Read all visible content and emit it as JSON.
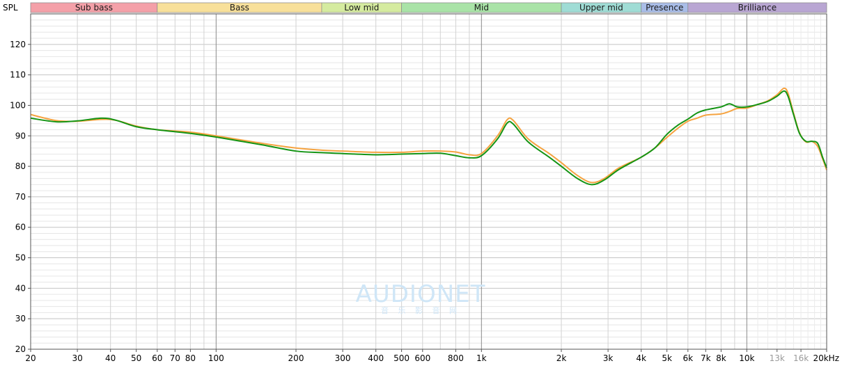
{
  "chart_data": {
    "type": "line",
    "ylabel": "SPL",
    "xunit": "Hz",
    "x_scale": "log",
    "xlim": [
      20,
      20000
    ],
    "ylim": [
      20,
      130
    ],
    "grid": true,
    "y_ticks": [
      20,
      30,
      40,
      50,
      60,
      70,
      80,
      90,
      100,
      110,
      120
    ],
    "x_ticks": [
      {
        "label": "20",
        "value": 20
      },
      {
        "label": "30",
        "value": 30
      },
      {
        "label": "40",
        "value": 40
      },
      {
        "label": "50",
        "value": 50
      },
      {
        "label": "60",
        "value": 60
      },
      {
        "label": "70",
        "value": 70
      },
      {
        "label": "80",
        "value": 80
      },
      {
        "label": "100",
        "value": 100
      },
      {
        "label": "200",
        "value": 200
      },
      {
        "label": "300",
        "value": 300
      },
      {
        "label": "400",
        "value": 400
      },
      {
        "label": "500",
        "value": 500
      },
      {
        "label": "600",
        "value": 600
      },
      {
        "label": "800",
        "value": 800
      },
      {
        "label": "1k",
        "value": 1000
      },
      {
        "label": "2k",
        "value": 2000
      },
      {
        "label": "3k",
        "value": 3000
      },
      {
        "label": "4k",
        "value": 4000
      },
      {
        "label": "5k",
        "value": 5000
      },
      {
        "label": "6k",
        "value": 6000
      },
      {
        "label": "7k",
        "value": 7000
      },
      {
        "label": "8k",
        "value": 8000
      },
      {
        "label": "10k",
        "value": 10000
      },
      {
        "label": "13k",
        "value": 13000,
        "muted": true
      },
      {
        "label": "16k",
        "value": 16000,
        "muted": true
      },
      {
        "label": "20kHz",
        "value": 20000
      }
    ],
    "bands": [
      {
        "name": "Sub bass",
        "from": 20,
        "to": 60,
        "color": "#f4a0a8"
      },
      {
        "name": "Bass",
        "from": 60,
        "to": 250,
        "color": "#f8e09a"
      },
      {
        "name": "Low mid",
        "from": 250,
        "to": 500,
        "color": "#d5eb9f"
      },
      {
        "name": "Mid",
        "from": 500,
        "to": 2000,
        "color": "#a9e3a7"
      },
      {
        "name": "Upper mid",
        "from": 2000,
        "to": 4000,
        "color": "#9fdcd5"
      },
      {
        "name": "Presence",
        "from": 4000,
        "to": 6000,
        "color": "#a9bde8"
      },
      {
        "name": "Brilliance",
        "from": 6000,
        "to": 20000,
        "color": "#b9a6d3"
      }
    ],
    "series": [
      {
        "color": "#149414",
        "points": [
          [
            20,
            95.8
          ],
          [
            25,
            94.6
          ],
          [
            30,
            94.9
          ],
          [
            37,
            95.8
          ],
          [
            42,
            95.1
          ],
          [
            50,
            93.0
          ],
          [
            60,
            92.0
          ],
          [
            80,
            90.8
          ],
          [
            100,
            89.6
          ],
          [
            150,
            87.0
          ],
          [
            200,
            85.0
          ],
          [
            250,
            84.5
          ],
          [
            300,
            84.2
          ],
          [
            400,
            83.8
          ],
          [
            500,
            84.0
          ],
          [
            600,
            84.2
          ],
          [
            700,
            84.3
          ],
          [
            800,
            83.5
          ],
          [
            900,
            82.8
          ],
          [
            1000,
            83.5
          ],
          [
            1150,
            89.0
          ],
          [
            1250,
            94.2
          ],
          [
            1320,
            93.8
          ],
          [
            1500,
            88.0
          ],
          [
            1800,
            83.0
          ],
          [
            2000,
            80.0
          ],
          [
            2300,
            76.0
          ],
          [
            2600,
            74.0
          ],
          [
            2900,
            75.5
          ],
          [
            3300,
            79.0
          ],
          [
            4000,
            83.0
          ],
          [
            4500,
            86.0
          ],
          [
            5000,
            90.5
          ],
          [
            5500,
            93.5
          ],
          [
            6000,
            95.5
          ],
          [
            6500,
            97.5
          ],
          [
            7000,
            98.5
          ],
          [
            8000,
            99.5
          ],
          [
            8600,
            100.5
          ],
          [
            9200,
            99.5
          ],
          [
            10000,
            99.5
          ],
          [
            11000,
            100.3
          ],
          [
            12000,
            101.3
          ],
          [
            13000,
            103.0
          ],
          [
            13800,
            104.7
          ],
          [
            14300,
            103.0
          ],
          [
            15000,
            97.0
          ],
          [
            15800,
            90.8
          ],
          [
            16700,
            88.2
          ],
          [
            17600,
            88.2
          ],
          [
            18500,
            87.5
          ],
          [
            19300,
            83.0
          ],
          [
            20000,
            79.5
          ]
        ]
      },
      {
        "color": "#f5a340",
        "points": [
          [
            20,
            97.0
          ],
          [
            25,
            95.0
          ],
          [
            30,
            94.8
          ],
          [
            37,
            95.4
          ],
          [
            42,
            95.1
          ],
          [
            50,
            93.2
          ],
          [
            60,
            92.0
          ],
          [
            80,
            91.2
          ],
          [
            100,
            90.0
          ],
          [
            150,
            87.5
          ],
          [
            200,
            86.0
          ],
          [
            250,
            85.3
          ],
          [
            300,
            85.0
          ],
          [
            400,
            84.6
          ],
          [
            500,
            84.6
          ],
          [
            600,
            85.0
          ],
          [
            700,
            85.0
          ],
          [
            800,
            84.7
          ],
          [
            900,
            83.8
          ],
          [
            1000,
            84.2
          ],
          [
            1150,
            90.0
          ],
          [
            1250,
            95.3
          ],
          [
            1320,
            95.0
          ],
          [
            1500,
            89.0
          ],
          [
            1800,
            84.2
          ],
          [
            2000,
            81.2
          ],
          [
            2300,
            77.0
          ],
          [
            2600,
            74.7
          ],
          [
            2900,
            76.0
          ],
          [
            3300,
            79.5
          ],
          [
            4000,
            83.0
          ],
          [
            4500,
            86.0
          ],
          [
            5000,
            89.5
          ],
          [
            5500,
            92.5
          ],
          [
            6000,
            94.8
          ],
          [
            6500,
            95.8
          ],
          [
            7000,
            96.8
          ],
          [
            8000,
            97.2
          ],
          [
            8600,
            98.0
          ],
          [
            9200,
            99.0
          ],
          [
            10000,
            99.1
          ],
          [
            11000,
            100.3
          ],
          [
            12000,
            101.5
          ],
          [
            13000,
            103.5
          ],
          [
            13800,
            105.6
          ],
          [
            14300,
            104.0
          ],
          [
            15000,
            97.5
          ],
          [
            15800,
            91.0
          ],
          [
            16700,
            88.0
          ],
          [
            17600,
            88.2
          ],
          [
            18500,
            86.5
          ],
          [
            19300,
            82.5
          ],
          [
            20000,
            78.8
          ]
        ]
      }
    ]
  },
  "watermark": {
    "main": "AUDIONET",
    "sub": "音 乐 影 音 网"
  }
}
